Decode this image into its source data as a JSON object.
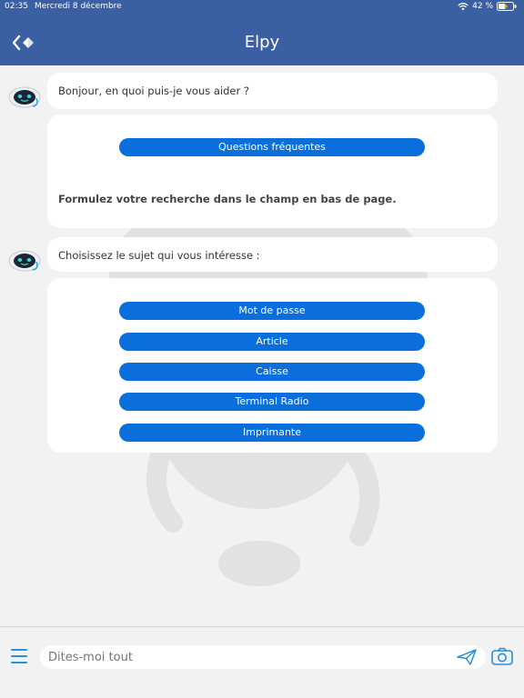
{
  "status": {
    "time": "02:35",
    "date": "Mercredi 8 décembre",
    "battery": "42 %"
  },
  "header": {
    "title": "Elpy"
  },
  "chat": {
    "message1": "Bonjour, en quoi puis-je vous aider ?",
    "faq_button": "Questions fréquentes",
    "hint": "Formulez votre recherche dans le champ en bas de page.",
    "message2": "Choisissez le sujet qui vous intéresse :",
    "topics": [
      "Mot de passe",
      "Article",
      "Caisse",
      "Terminal Radio",
      "Imprimante"
    ]
  },
  "input": {
    "placeholder": "Dites-moi tout"
  },
  "colors": {
    "header": "#3a5fa3",
    "button": "#0a6fdc",
    "accent_icon": "#2b8fd6"
  }
}
